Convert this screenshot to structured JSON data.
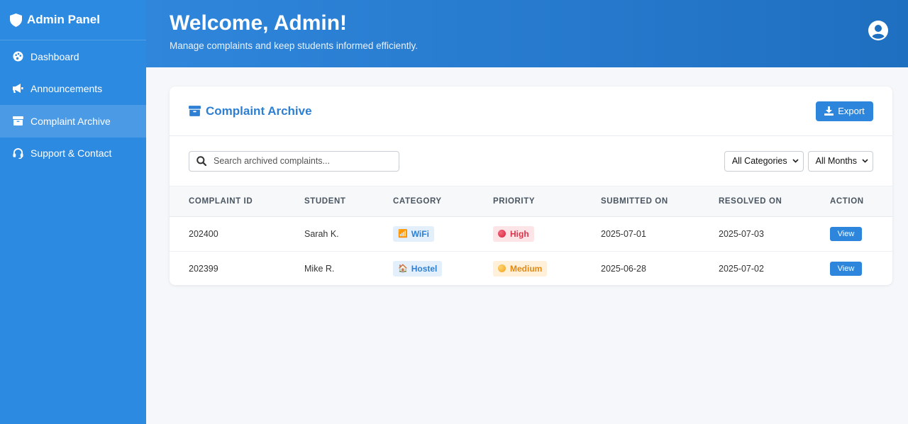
{
  "sidebar": {
    "brand": "Admin Panel",
    "items": [
      {
        "label": "Dashboard",
        "icon": "palette-icon"
      },
      {
        "label": "Announcements",
        "icon": "megaphone-icon"
      },
      {
        "label": "Complaint Archive",
        "icon": "archive-icon",
        "active": true
      },
      {
        "label": "Support & Contact",
        "icon": "headset-icon"
      }
    ]
  },
  "header": {
    "title": "Welcome, Admin!",
    "subtitle": "Manage complaints and keep students informed efficiently."
  },
  "card": {
    "title": "Complaint Archive",
    "export_label": "Export",
    "search_placeholder": "Search archived complaints...",
    "category_filter": "All Categories",
    "month_filter": "All Months"
  },
  "table": {
    "headers": [
      "Complaint ID",
      "Student",
      "Category",
      "Priority",
      "Submitted On",
      "Resolved On",
      "Action"
    ],
    "rows": [
      {
        "id": "202400",
        "student": "Sarah K.",
        "category": "WiFi",
        "category_icon": "📶",
        "priority": "High",
        "submitted": "2025-07-01",
        "resolved": "2025-07-03",
        "action": "View"
      },
      {
        "id": "202399",
        "student": "Mike R.",
        "category": "Hostel",
        "category_icon": "🏠",
        "priority": "Medium",
        "submitted": "2025-06-28",
        "resolved": "2025-07-02",
        "action": "View"
      }
    ]
  },
  "colors": {
    "sidebar": "#2d8ae1",
    "accent": "#2d86dc",
    "high": "#d9344a",
    "medium": "#e08a14"
  }
}
